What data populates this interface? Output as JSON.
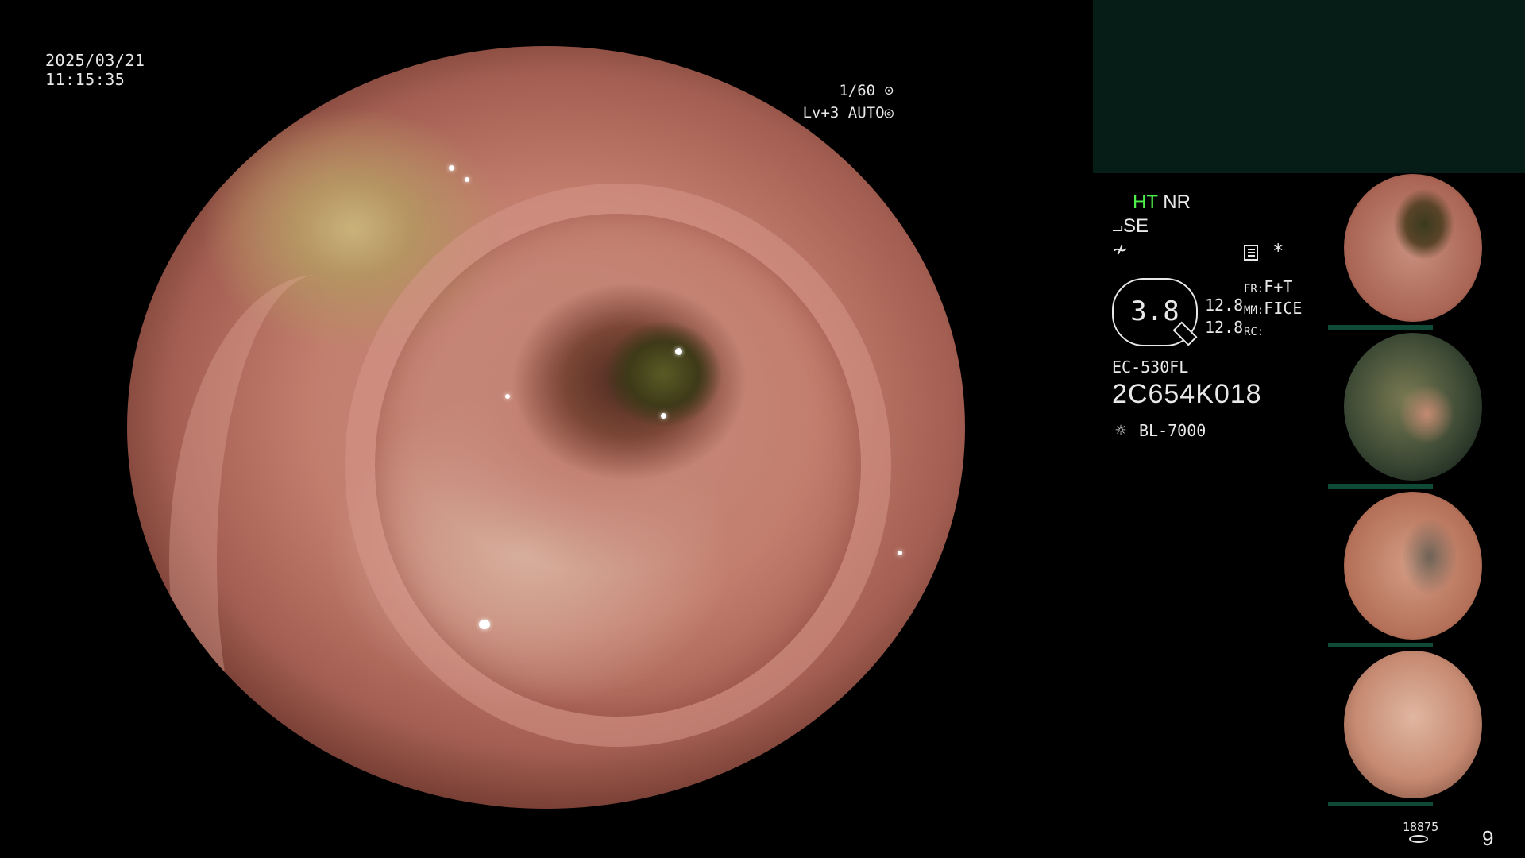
{
  "timestamp": {
    "date": "2025/03/21",
    "time": "11:15:35"
  },
  "shutter": {
    "speed": "1/60",
    "level": "Lv+3",
    "mode": "AUTO"
  },
  "info": {
    "ht": "HT",
    "nr": "NR",
    "se": "SE",
    "enhancement": "3.8",
    "value_a": "12.8",
    "value_b": "12.8",
    "fr_key": "FR:",
    "fr_val": "F+T",
    "mm_key": "MM:",
    "mm_val": "FICE",
    "rc_key": "RC:",
    "star": "*",
    "scope_model": "EC-530FL",
    "scope_serial": "2C654K018",
    "light_source": "BL-7000"
  },
  "footer": {
    "image_count": "18875",
    "page": "9"
  },
  "colors": {
    "accent_green": "#4ef04a",
    "panel_bg": "#061c17",
    "thumb_bar": "#0f4a37"
  }
}
